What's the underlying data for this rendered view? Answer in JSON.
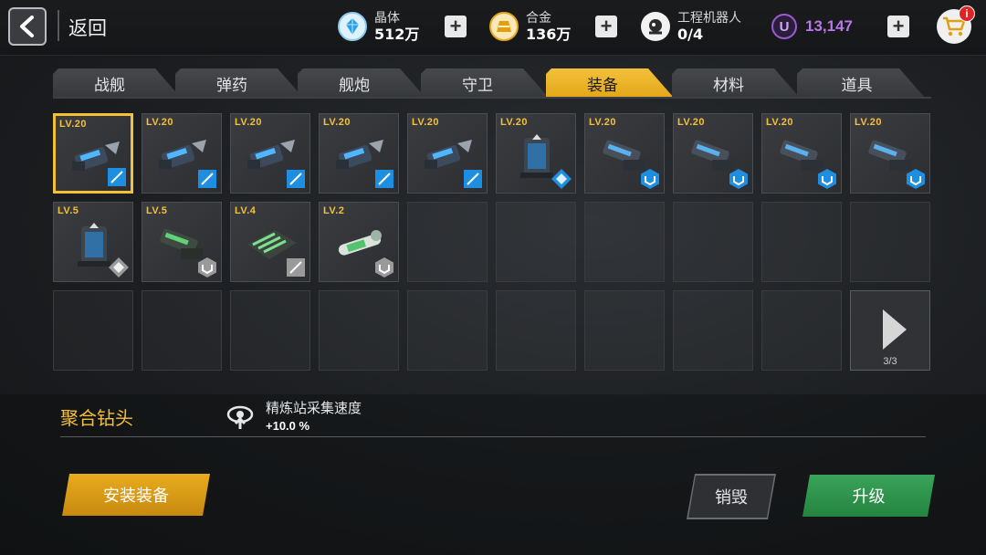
{
  "header": {
    "back_label": "返回",
    "resources": [
      {
        "name": "晶体",
        "value": "512万",
        "icon": "crystal-icon"
      },
      {
        "name": "合金",
        "value": "136万",
        "icon": "alloy-icon"
      },
      {
        "name": "工程机器人",
        "value": "0/4",
        "icon": "robot-icon"
      }
    ],
    "premium_icon_letter": "U",
    "premium_value": "13,147",
    "notification_count": "i"
  },
  "tabs": [
    {
      "label": "战舰",
      "active": false
    },
    {
      "label": "弹药",
      "active": false
    },
    {
      "label": "舰炮",
      "active": false
    },
    {
      "label": "守卫",
      "active": false
    },
    {
      "label": "装备",
      "active": true
    },
    {
      "label": "材料",
      "active": false
    },
    {
      "label": "道具",
      "active": false
    }
  ],
  "inventory": {
    "items": [
      {
        "level": "LV.20",
        "kind": "drill",
        "badge": "square",
        "rarity_color": "#1e8fe0",
        "selected": true
      },
      {
        "level": "LV.20",
        "kind": "drill",
        "badge": "square",
        "rarity_color": "#1e8fe0",
        "selected": false
      },
      {
        "level": "LV.20",
        "kind": "drill",
        "badge": "square",
        "rarity_color": "#1e8fe0",
        "selected": false
      },
      {
        "level": "LV.20",
        "kind": "drill",
        "badge": "square",
        "rarity_color": "#1e8fe0",
        "selected": false
      },
      {
        "level": "LV.20",
        "kind": "drill",
        "badge": "square",
        "rarity_color": "#1e8fe0",
        "selected": false
      },
      {
        "level": "LV.20",
        "kind": "tower",
        "badge": "diamond",
        "rarity_color": "#1e8fe0",
        "selected": false
      },
      {
        "level": "LV.20",
        "kind": "cannon",
        "badge": "hex",
        "rarity_color": "#1e8fe0",
        "selected": false
      },
      {
        "level": "LV.20",
        "kind": "cannon",
        "badge": "hex",
        "rarity_color": "#1e8fe0",
        "selected": false
      },
      {
        "level": "LV.20",
        "kind": "cannon",
        "badge": "hex",
        "rarity_color": "#1e8fe0",
        "selected": false
      },
      {
        "level": "LV.20",
        "kind": "cannon",
        "badge": "hex",
        "rarity_color": "#1e8fe0",
        "selected": false
      },
      {
        "level": "LV.5",
        "kind": "tower",
        "badge": "diamond",
        "rarity_color": "#9a9a9a",
        "selected": false
      },
      {
        "level": "LV.5",
        "kind": "cannon-green",
        "badge": "hex",
        "rarity_color": "#9a9a9a",
        "selected": false
      },
      {
        "level": "LV.4",
        "kind": "plate-green",
        "badge": "square",
        "rarity_color": "#9a9a9a",
        "selected": false
      },
      {
        "level": "LV.2",
        "kind": "pipe-green",
        "badge": "hex",
        "rarity_color": "#9a9a9a",
        "selected": false
      }
    ],
    "page_indicator": "3/3"
  },
  "detail": {
    "item_name": "聚合钻头",
    "stat_name": "精炼站采集速度",
    "stat_value": "+10.0 %"
  },
  "actions": {
    "install_label": "安装装备",
    "destroy_label": "销毁",
    "upgrade_label": "升级"
  },
  "colors": {
    "accent": "#f3c03a",
    "premium": "#b877e9",
    "upgrade": "#2f9a4e",
    "rare": "#1e8fe0",
    "common": "#9a9a9a"
  }
}
